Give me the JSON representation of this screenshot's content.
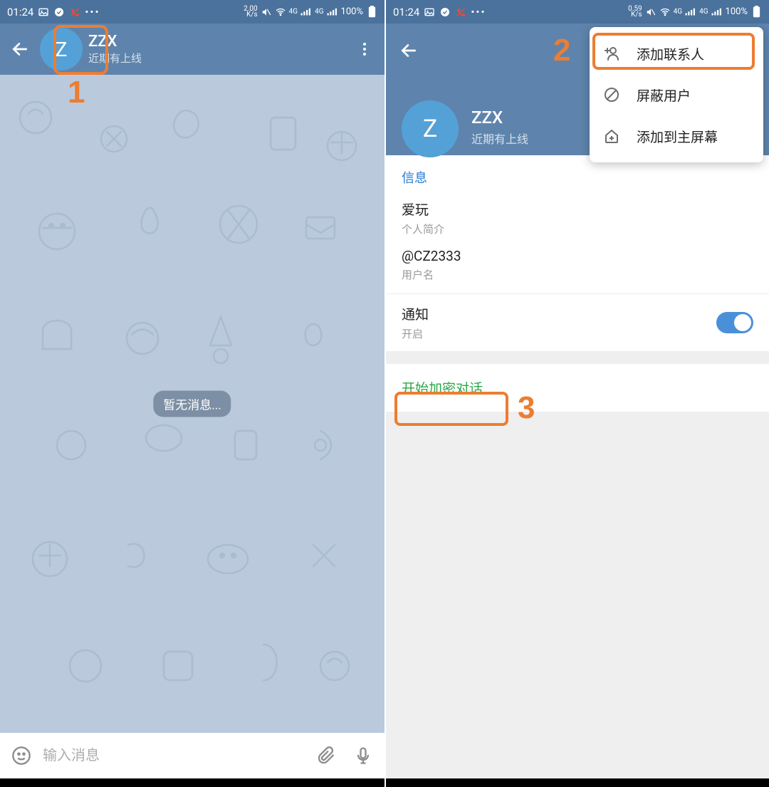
{
  "statusbar": {
    "time": "01:24",
    "speed1": "2.00",
    "speed_unit": "K/s",
    "speed2": "0.59",
    "signal_label": "4G",
    "battery": "100%"
  },
  "chat": {
    "avatar_letter": "Z",
    "name": "ZZX",
    "last_seen": "近期有上线",
    "empty_text": "暂无消息...",
    "input_placeholder": "输入消息"
  },
  "profile": {
    "avatar_letter": "Z",
    "name": "ZZX",
    "last_seen": "近期有上线",
    "section_info": "信息",
    "bio_value": "爱玩",
    "bio_label": "个人简介",
    "username_value": "@CZ2333",
    "username_label": "用户名",
    "notif_title": "通知",
    "notif_status": "开启",
    "secret_chat": "开始加密对话"
  },
  "menu": {
    "add_contact": "添加联系人",
    "block_user": "屏蔽用户",
    "add_home": "添加到主屏幕"
  },
  "annotations": {
    "n1": "1",
    "n2": "2",
    "n3": "3"
  }
}
